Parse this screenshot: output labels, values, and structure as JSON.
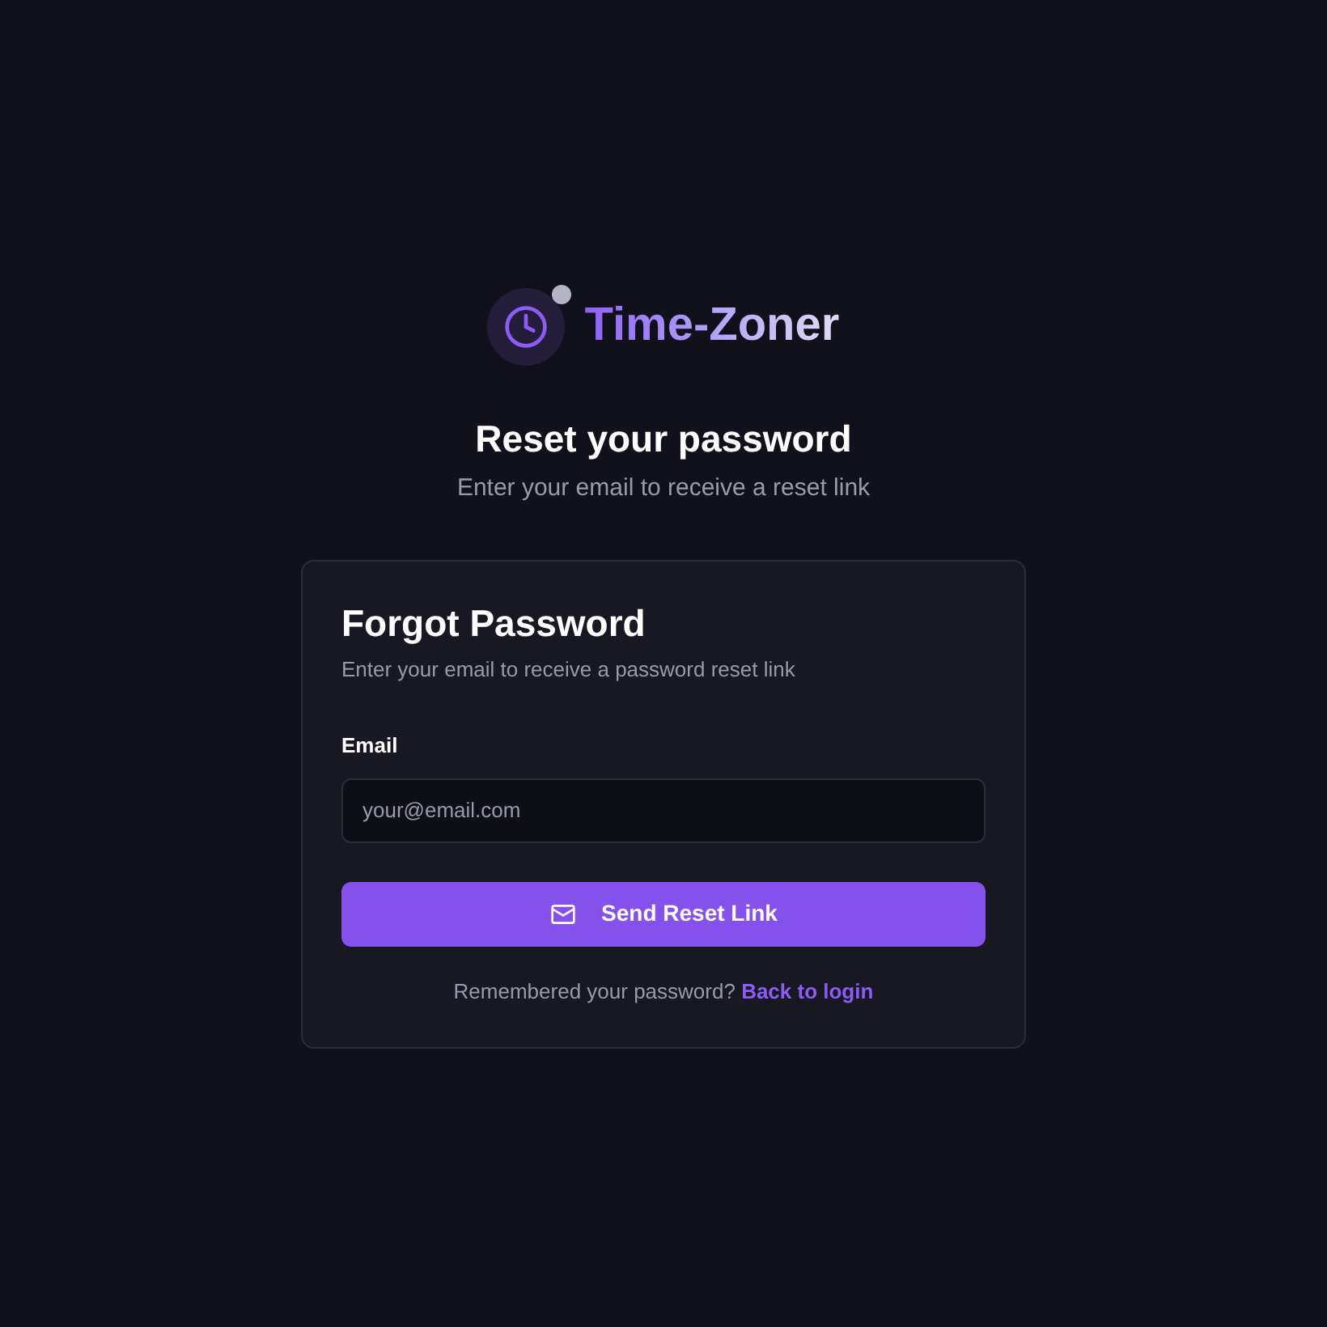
{
  "logo": {
    "text": "Time-Zoner"
  },
  "header": {
    "title": "Reset your password",
    "subtitle": "Enter your email to receive a reset link"
  },
  "card": {
    "title": "Forgot Password",
    "description": "Enter your email to receive a password reset link",
    "email_field": {
      "label": "Email",
      "placeholder": "your@email.com"
    },
    "submit_button": {
      "label": "Send Reset Link"
    },
    "footer": {
      "text": "Remembered your password?",
      "link": "Back to login"
    }
  }
}
